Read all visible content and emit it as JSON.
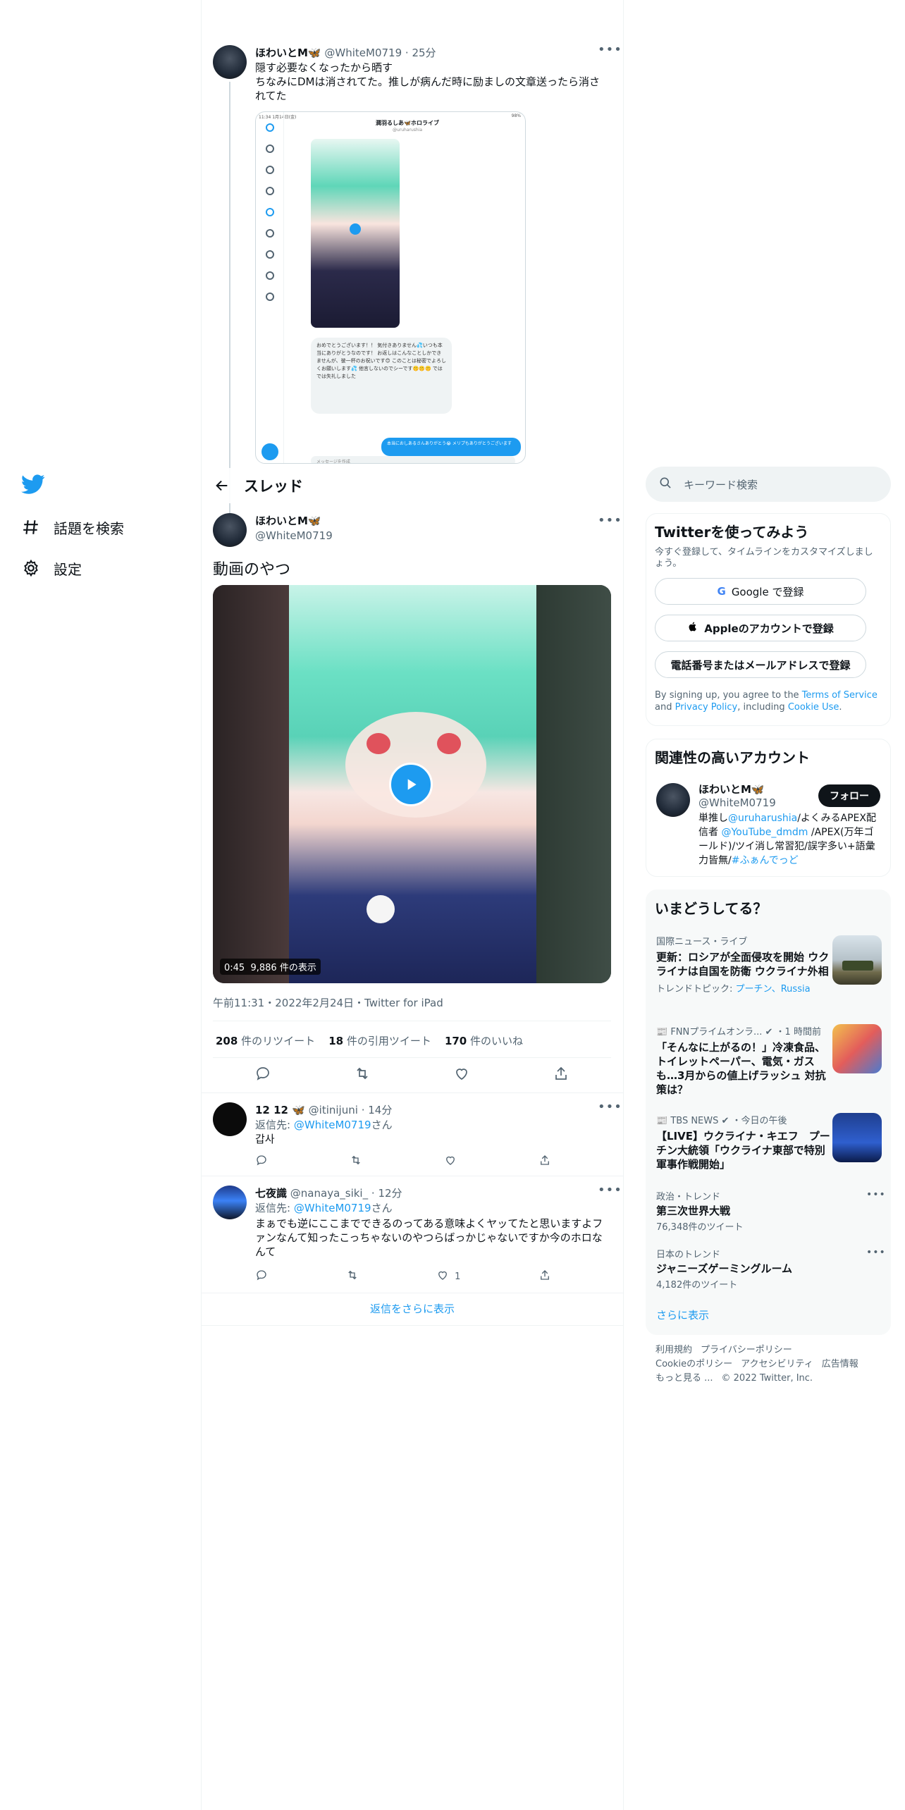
{
  "nav": {
    "items": [
      {
        "label": "話題を検索",
        "icon": "hashtag-icon"
      },
      {
        "label": "設定",
        "icon": "gear-icon"
      }
    ]
  },
  "header": {
    "title": "スレッド"
  },
  "prev_tweet": {
    "name": "ほわいとM🦋",
    "handle": "@WhiteM0719",
    "time": "25分",
    "line1": "隠す必要なくなったから晒す",
    "line2": "ちなみにDMは消されてた。推しが病んだ時に励ましの文章送ったら消されてた",
    "image": {
      "status_left": "11:34 1月14日(金)",
      "status_right": "98%",
      "chat_title": "潤羽るしあ🦋ホロライブ",
      "chat_sub": "@uruharushia",
      "bubble_text": "おめでとうございます！！ 気付きありません💦いつも本当にありがとうなのです！ お返しはこんなことしかできませんが、彼一杯のお祝いです😊 このことは秘密でよろしくお願いします💦 他言しないのでシーです🤫🤫🤫 ではでは失礼しました",
      "blue_text": "本当におしあるさんありがとう😭 メリプもありがとうございます",
      "compose_placeholder": "メッセージを作成"
    }
  },
  "main_tweet": {
    "name": "ほわいとM🦋",
    "handle": "@WhiteM0719",
    "text": "動画のやつ",
    "video": {
      "duration": "0:45",
      "views": "9,886 件の表示"
    },
    "meta": "午前11:31・2022年2月24日・Twitter for iPad",
    "stats": {
      "retweets_num": "208",
      "retweets_label": "件のリツイート",
      "quotes_num": "18",
      "quotes_label": "件の引用ツイート",
      "likes_num": "170",
      "likes_label": "件のいいね"
    }
  },
  "replies": [
    {
      "name": "12 12 🦋",
      "handle": "@itinijuni",
      "time": "14分",
      "reply_to_prefix": "返信先: ",
      "reply_to_handle": "@WhiteM0719",
      "reply_to_suffix": "さん",
      "text": "갑사",
      "likes": ""
    },
    {
      "name": "七夜識",
      "handle": "@nanaya_siki_",
      "time": "12分",
      "reply_to_prefix": "返信先: ",
      "reply_to_handle": "@WhiteM0719",
      "reply_to_suffix": "さん",
      "text": "まぁでも逆にここまでできるのってある意味よくヤッてたと思いますよファンなんて知ったこっちゃないのやつらばっかじゃないですか今のホロなんて",
      "likes": "1"
    }
  ],
  "show_more_replies": "返信をさらに表示",
  "search": {
    "placeholder": "キーワード検索"
  },
  "signup": {
    "title": "Twitterを使ってみよう",
    "sub": "今すぐ登録して、タイムラインをカスタマイズしましょう。",
    "google": "Google で登録",
    "apple": "Appleのアカウントで登録",
    "phone": "電話番号またはメールアドレスで登録",
    "legal_1": "By signing up, you agree to the ",
    "terms": "Terms of Service",
    "legal_2": " and ",
    "privacy": "Privacy Policy",
    "legal_3": ", including ",
    "cookie": "Cookie Use",
    "legal_4": "."
  },
  "relevant": {
    "title": "関連性の高いアカウント",
    "name": "ほわいとM🦋",
    "handle": "@WhiteM0719",
    "follow": "フォロー",
    "bio_1": "単推し",
    "bio_link1": "@uruharushia",
    "bio_2": "/よくみるAPEX配信者 ",
    "bio_link2": "@YouTube_dmdm",
    "bio_3": " /APEX(万年ゴールド)/ツイ消し常習犯/誤字多い+語彙力皆無/",
    "bio_link3": "#ふぁんでっど"
  },
  "trends": {
    "title": "いまどうしてる？",
    "items": [
      {
        "cat": "国際ニュース・ライブ",
        "title": "更新：ロシアが全面侵攻を開始 ウクライナは自国を防衛 ウクライナ外相",
        "extra_prefix": "トレンドトピック: ",
        "extra_links": "プーチン、Russia"
      },
      {
        "cat": "📰 FNNプライムオンラ... ✔ ・1 時間前",
        "title": "「そんなに上がるの！」冷凍食品、トイレットペーパー、電気・ガスも…3月からの値上げラッシュ 対抗策は？"
      },
      {
        "cat": "📰 TBS NEWS ✔ ・今日の午後",
        "title": "【LIVE】ウクライナ・キエフ　プーチン大統領「ウクライナ東部で特別軍事作戦開始」"
      },
      {
        "cat": "政治・トレンド",
        "title": "第三次世界大戦",
        "count": "76,348件のツイート"
      },
      {
        "cat": "日本のトレンド",
        "title": "ジャニーズゲーミングルーム",
        "count": "4,182件のツイート"
      }
    ],
    "show_more": "さらに表示"
  },
  "footer": {
    "links": [
      "利用規約",
      "プライバシーポリシー",
      "Cookieのポリシー",
      "アクセシビリティ",
      "広告情報",
      "もっと見る ..."
    ],
    "copyright": "© 2022 Twitter, Inc."
  },
  "colors": {
    "accent": "#1d9bf0",
    "text": "#0f1419",
    "muted": "#536471",
    "border": "#eff3f4"
  }
}
